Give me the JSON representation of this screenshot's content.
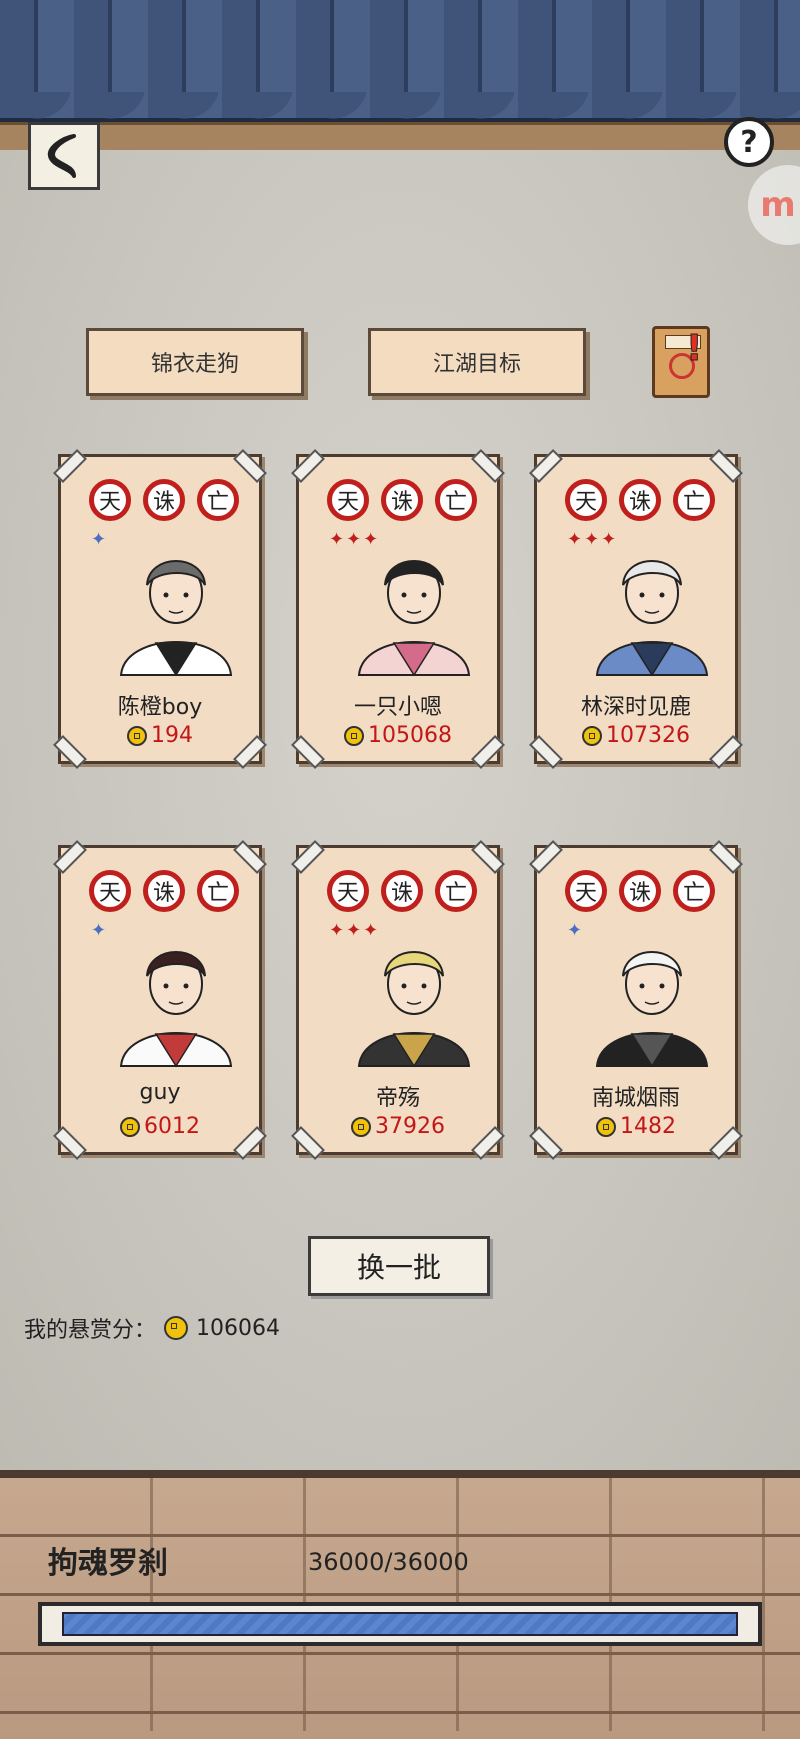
{
  "header": {
    "back_icon": "back-arrow-icon",
    "help_label": "?",
    "float_badge_label": "m"
  },
  "tabs": [
    {
      "label": "锦衣走狗"
    },
    {
      "label": "江湖目标"
    }
  ],
  "seal_chars": [
    "天",
    "诛",
    "亡"
  ],
  "cards": [
    {
      "name": "陈橙boy",
      "bounty": "194",
      "stars": 1,
      "star_color": "blue"
    },
    {
      "name": "一只小嗯",
      "bounty": "105068",
      "stars": 3,
      "star_color": "red"
    },
    {
      "name": "林深时见鹿",
      "bounty": "107326",
      "stars": 3,
      "star_color": "red"
    },
    {
      "name": "guy",
      "bounty": "6012",
      "stars": 1,
      "star_color": "blue"
    },
    {
      "name": "帝殇",
      "bounty": "37926",
      "stars": 3,
      "star_color": "red"
    },
    {
      "name": "南城烟雨",
      "bounty": "1482",
      "stars": 1,
      "star_color": "blue"
    }
  ],
  "refresh_label": "换一批",
  "my_score": {
    "label": "我的悬赏分：",
    "value": "106064"
  },
  "boss": {
    "name": "拘魂罗刹",
    "hp_text": "36000/36000",
    "hp_fraction": 1.0
  },
  "colors": {
    "roof": "#3f5478",
    "card_bg": "#f2dcc4",
    "seal_red": "#c0201d",
    "bounty_red": "#c41616",
    "hp_blue": "#4f79c3"
  }
}
